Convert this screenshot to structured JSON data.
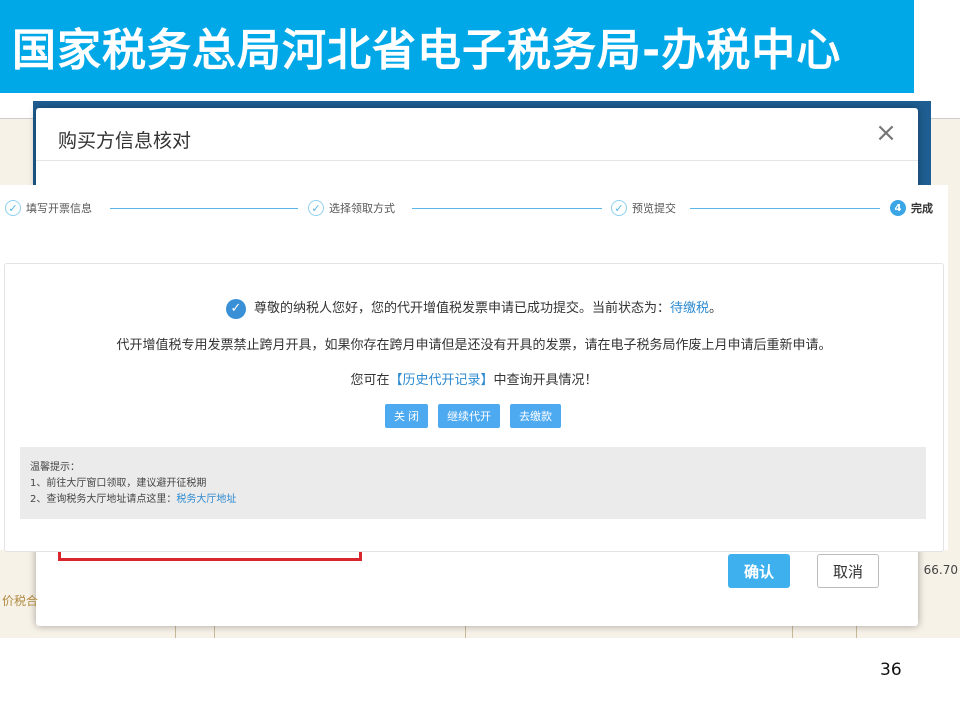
{
  "slide": {
    "title": "国家税务总局河北省电子税务局-办税中心",
    "page_number": "36"
  },
  "background": {
    "amount_text": "66.70",
    "price_label": "价税合"
  },
  "modal": {
    "title": "购买方信息核对",
    "close_symbol": "×",
    "confirm_label": "确认",
    "cancel_label": "取消"
  },
  "steps": [
    {
      "label": "填写开票信息",
      "number": "✓",
      "state": "done"
    },
    {
      "label": "选择领取方式",
      "number": "✓",
      "state": "done"
    },
    {
      "label": "预览提交",
      "number": "✓",
      "state": "done"
    },
    {
      "label": "完成",
      "number": "4",
      "state": "active"
    }
  ],
  "result": {
    "line1_prefix": "尊敬的纳税人您好，您的代开增值税发票申请已成功提交。当前状态为：",
    "status": "待缴税",
    "line1_suffix": "。",
    "line2": "代开增值税专用发票禁止跨月开具，如果你存在跨月申请但是还没有开具的发票，请在电子税务局作废上月申请后重新申请。",
    "line3_prefix": "您可在",
    "history_link": "【历史代开记录】",
    "line3_suffix": "中查询开具情况！",
    "buttons": [
      "关 闭",
      "继续代开",
      "去缴款"
    ]
  },
  "tips": {
    "heading": "温馨提示：",
    "item1": "1、前往大厅窗口领取，建议避开征税期",
    "item2_prefix": "2、查询税务大厅地址请点这里：",
    "item2_link": "税务大厅地址"
  },
  "colors": {
    "banner": "#00a8e8",
    "accent": "#3eb0ee",
    "highlight": "#d9262c"
  }
}
